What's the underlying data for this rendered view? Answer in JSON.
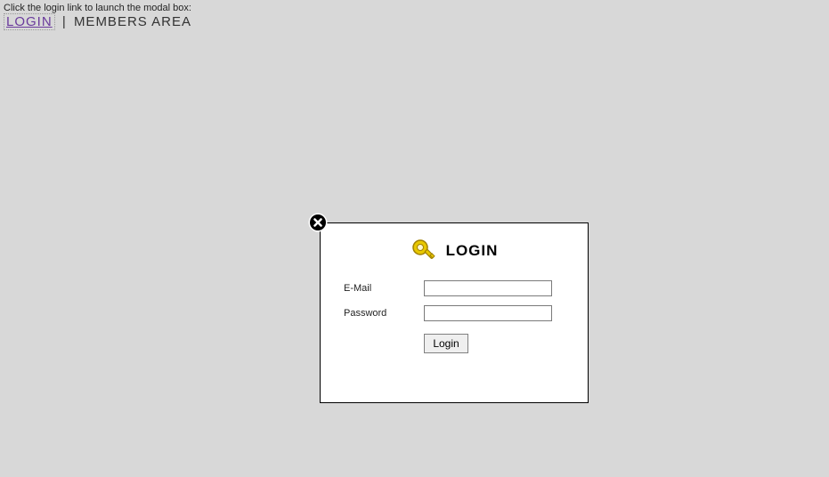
{
  "header": {
    "instruction": "Click the login link to launch the modal box:",
    "login_link": "LOGIN",
    "separator": "|",
    "members_link": "MEMBERS AREA"
  },
  "modal": {
    "title": "LOGIN",
    "fields": {
      "email_label": "E-Mail",
      "email_value": "",
      "password_label": "Password",
      "password_value": ""
    },
    "button_label": "Login"
  }
}
